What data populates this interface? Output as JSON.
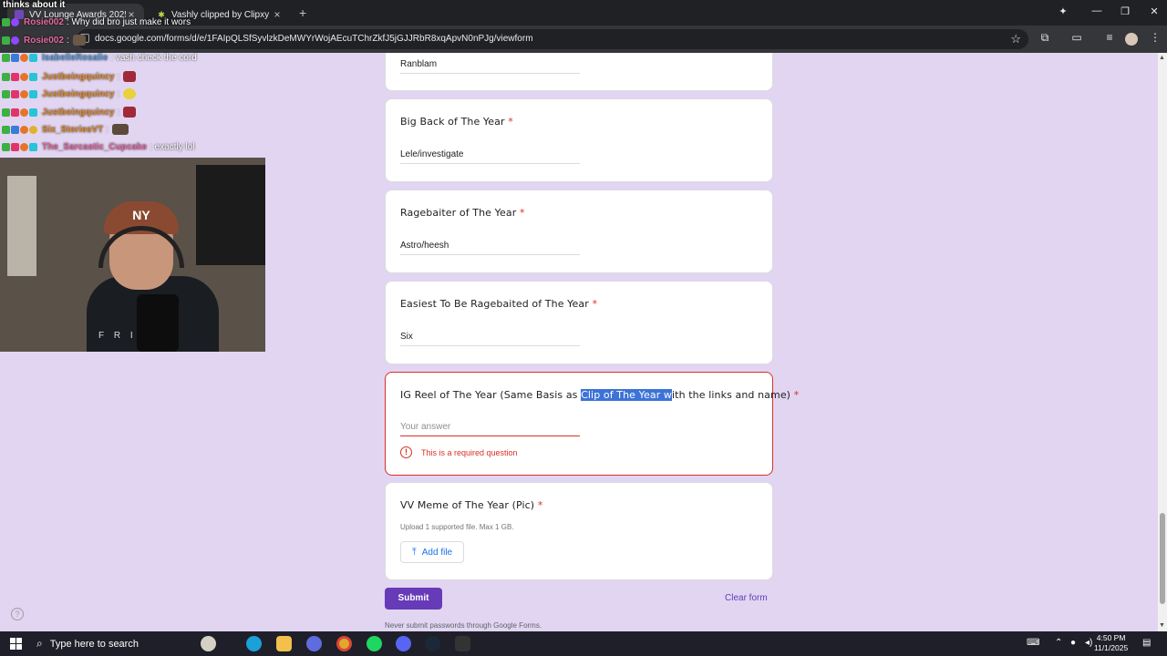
{
  "browser": {
    "tabs": [
      {
        "title": "VV Lounge Awards 2025",
        "active": true
      },
      {
        "title": "Vashly clipped by Clipxy",
        "active": false
      }
    ],
    "url": "docs.google.com/forms/d/e/1FAIpQLSfSyvlzkDeMWYrWojAEcuTChrZkfJ5jGJJRbR8xqApvN0nPJg/viewform"
  },
  "form": {
    "prev_answer": "Ranblam",
    "questions": [
      {
        "title": "Big Back of The Year",
        "answer": "Lele/investigate"
      },
      {
        "title": "Ragebaiter of The Year",
        "answer": "Astro/heesh"
      },
      {
        "title": "Easiest To Be Ragebaited of The Year",
        "answer": "Six"
      }
    ],
    "ig_question": {
      "title_pre": "IG Reel of The Year (Same Basis as ",
      "title_hl": "Clip of The Year w",
      "title_post": "ith the links and name)",
      "placeholder": "Your answer",
      "error": "This is a required question"
    },
    "meme_question": {
      "title": "VV Meme of The Year (Pic)",
      "hint": "Upload 1 supported file. Max 1 GB.",
      "button": "Add file"
    },
    "required_mark": "*",
    "submit": "Submit",
    "clear": "Clear form",
    "never": "Never submit passwords through Google Forms."
  },
  "overlay": {
    "thinking": "thinks about it",
    "chat": [
      {
        "name": "Rosie002",
        "msg": ": Why did bro just make it wors",
        "color": "#e36aa0"
      },
      {
        "name": "Rosie002",
        "msg": ":",
        "color": "#e36aa0"
      },
      {
        "name": "IsabelleRosalie",
        "msg": ": vash check the cord",
        "color": "#5b9bd5"
      },
      {
        "name": "Justbeingquincy",
        "msg": ":",
        "color": "#e08a2c"
      },
      {
        "name": "Justbeingquincy",
        "msg": ":",
        "color": "#e08a2c"
      },
      {
        "name": "Justbeingquincy",
        "msg": ":",
        "color": "#e08a2c"
      },
      {
        "name": "Six_StoriesVT",
        "msg": ":",
        "color": "#e08a2c"
      },
      {
        "name": "The_Sarcastic_Cupcake",
        "msg": ": exactly lol",
        "color": "#e36aa0"
      }
    ],
    "cam_text": "F R I"
  },
  "taskbar": {
    "search_placeholder": "Type here to search",
    "time": "4:50 PM",
    "date": "11/1/2025"
  }
}
